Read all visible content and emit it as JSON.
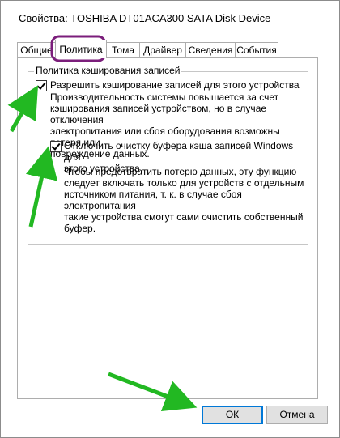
{
  "window": {
    "title": "Свойства: TOSHIBA DT01ACA300 SATA Disk Device"
  },
  "tabs": [
    {
      "label": "Общие"
    },
    {
      "label": "Политика"
    },
    {
      "label": "Тома"
    },
    {
      "label": "Драйвер"
    },
    {
      "label": "Сведения"
    },
    {
      "label": "События"
    }
  ],
  "group": {
    "title": "Политика кэширования записей",
    "option1": {
      "label": "Разрешить кэширование записей для этого устройства",
      "checked": true,
      "description": "Производительность системы повышается за счет\nкэширования записей устройством, но в случае отключения\nэлектропитания или сбоя оборудования возможны потеря или\nповреждение данных."
    },
    "option2": {
      "label": "Отключить очистку буфера кэша записей Windows для\nэтого устройства",
      "checked": true,
      "description": "Чтобы предотвратить потерю данных, эту функцию\nследует включать только для устройств с отдельным\nисточником питания, т. к.  в случае сбоя электропитания\nтакие устройства смогут сами очистить собственный\nбуфер."
    }
  },
  "buttons": {
    "ok": "ОК",
    "cancel": "Отмена"
  },
  "colors": {
    "annotation_arrow": "#22b822",
    "tab_highlight": "#7b1e7b",
    "default_button_border": "#0078d7"
  }
}
